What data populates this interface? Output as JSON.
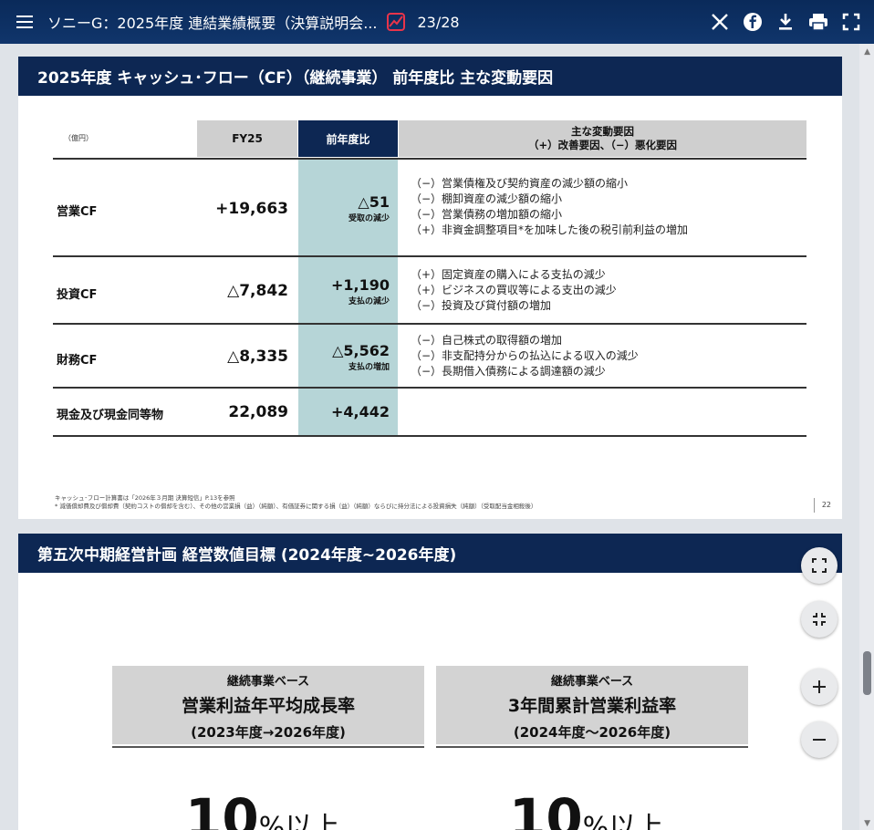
{
  "toolbar": {
    "document_title": "ソニーG：2025年度 連結業績概要（決算説明会...",
    "page_counter": "23/28"
  },
  "slide1": {
    "title": "2025年度 キャッシュ･フロー（CF）（継続事業） 前年度比 主な変動要因",
    "unit": "（億円）",
    "col_fy": "FY25",
    "col_yoy": "前年度比",
    "col_factor_line1": "主な変動要因",
    "col_factor_line2": "（+）改善要因、（−）悪化要因",
    "rows": [
      {
        "label": "営業CF",
        "fy": "+19,663",
        "yoy": "△51",
        "yoy_sub": "受取の減少",
        "factors": [
          "（−）営業債権及び契約資産の減少額の縮小",
          "（−）棚卸資産の減少額の縮小",
          "（−）営業債務の増加額の縮小",
          "（+）非資金調整項目*を加味した後の税引前利益の増加"
        ]
      },
      {
        "label": "投資CF",
        "fy": "△7,842",
        "yoy": "+1,190",
        "yoy_sub": "支払の減少",
        "factors": [
          "（+）固定資産の購入による支払の減少",
          "（+）ビジネスの買収等による支出の減少",
          "（−）投資及び貸付額の増加"
        ]
      },
      {
        "label": "財務CF",
        "fy": "△8,335",
        "yoy": "△5,562",
        "yoy_sub": "支払の増加",
        "factors": [
          "（−）自己株式の取得額の増加",
          "（−）非支配持分からの払込による収入の減少",
          "（−）長期借入債務による調達額の減少"
        ]
      },
      {
        "label": "現金及び現金同等物",
        "fy": "22,089",
        "yoy": "+4,442",
        "yoy_sub": "",
        "factors": []
      }
    ],
    "footnote1": "キャッシュ･フロー計算書は「2026年３月期 決算短信」P.13を参照",
    "footnote2": "*  減価償却費及び償却費（契約コストの償却を含む）、その他の営業損（益）（純額）、有価証券に関する損（益）（純額）ならびに持分法による投資損失（純額）（受取配当金相殺後）",
    "page_number": "22"
  },
  "slide2": {
    "title": "第五次中期経営計画 経営数値目標 (2024年度~2026年度)",
    "kpi1": {
      "sub": "継続事業ベース",
      "main": "営業利益年平均成長率",
      "period": "(2023年度→2026年度)",
      "value": "10",
      "unit": "%以上"
    },
    "kpi2": {
      "sub": "継続事業ベース",
      "main": "3年間累計営業利益率",
      "period": "(2024年度～2026年度)",
      "value": "10",
      "unit": "%以上"
    }
  },
  "icons": {
    "menu": "hamburger-icon",
    "logo": "chart-logo-icon",
    "x": "x-logo-icon",
    "facebook": "facebook-icon",
    "download": "download-icon",
    "print": "print-icon",
    "fullscreen": "fullscreen-icon",
    "zoom_fit": "fit-page-icon",
    "zoom_shrink": "shrink-icon",
    "zoom_in": "plus-icon",
    "zoom_out": "minus-icon"
  }
}
